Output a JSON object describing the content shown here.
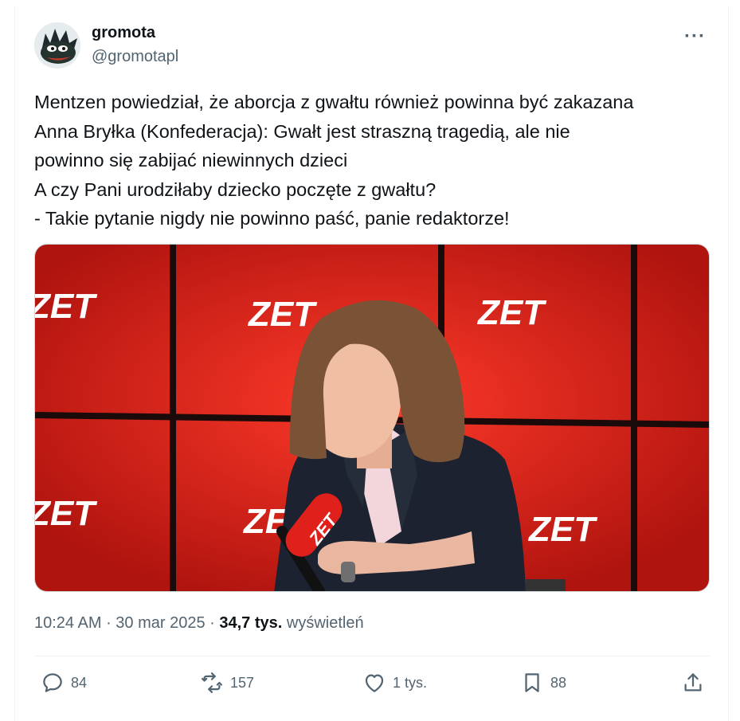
{
  "user": {
    "display_name": "gromota",
    "handle": "@gromotapl",
    "avatar_icon": "pepe-dragon-avatar"
  },
  "more_icon": "more-horizontal-icon",
  "more_label": "···",
  "tweet": {
    "lines": [
      "Mentzen powiedział, że aborcja z gwałtu również powinna być zakazana",
      "Anna Bryłka (Konfederacja): Gwałt jest straszną tragedią, ale nie",
      "powinno się zabijać niewinnych dzieci",
      "A czy Pani urodziłaby dziecko poczęte z gwałtu?",
      "- Takie pytanie nigdy nie powinno paść, panie redaktorze!"
    ]
  },
  "media": {
    "logo_text": "ZET",
    "mic_text": "ZET"
  },
  "meta": {
    "time": "10:24 AM",
    "sep1": " · ",
    "date": "30 mar 2025",
    "sep2": " · ",
    "views_count": "34,7 tys.",
    "views_label": "wyświetleń"
  },
  "actions": {
    "replies": "84",
    "reposts": "157",
    "likes": "1 tys.",
    "bookmarks": "88"
  },
  "colors": {
    "studio_red": "#d8231c",
    "text_secondary": "#536471",
    "text_primary": "#0f1419"
  }
}
